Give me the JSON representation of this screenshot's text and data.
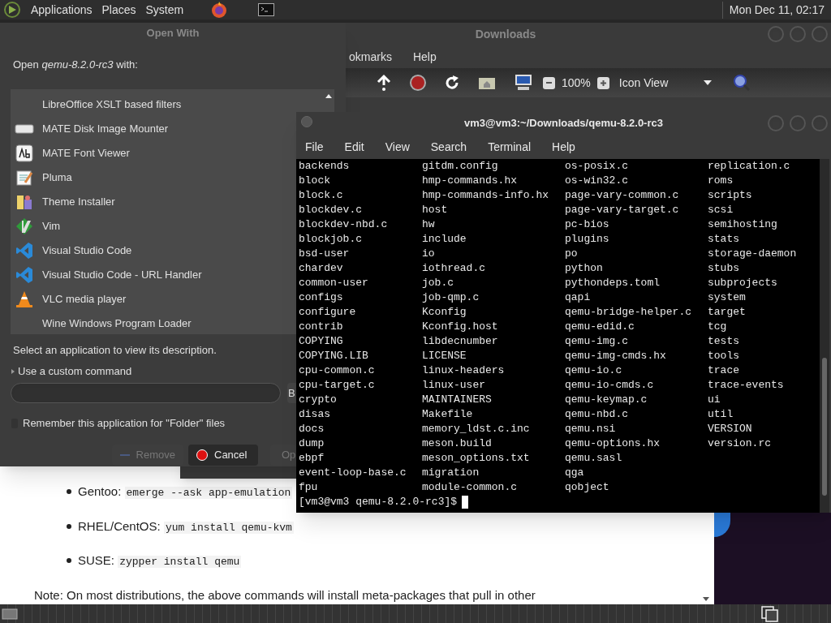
{
  "top_panel": {
    "menus": [
      "Applications",
      "Places",
      "System"
    ],
    "clock": "Mon Dec 11, 02:17"
  },
  "file_manager": {
    "title": "Downloads",
    "menu": [
      "okmarks",
      "Help"
    ],
    "zoom": "100%",
    "view": "Icon View"
  },
  "open_with": {
    "title": "Open With",
    "prompt": "Open *qemu-8.2.0-rc3* with:",
    "apps": [
      {
        "name": "LibreOffice XSLT based filters",
        "selected": false
      },
      {
        "name": "MATE Disk Image Mounter",
        "selected": false
      },
      {
        "name": "MATE Font Viewer",
        "selected": false
      },
      {
        "name": "Pluma",
        "selected": false
      },
      {
        "name": "Theme Installer",
        "selected": false
      },
      {
        "name": "Vim",
        "selected": false
      },
      {
        "name": "Visual Studio Code",
        "selected": false
      },
      {
        "name": "Visual Studio Code - URL Handler",
        "selected": false
      },
      {
        "name": "VLC media player",
        "selected": false
      },
      {
        "name": "Wine Windows Program Loader",
        "selected": false
      }
    ],
    "description": "Select an application to view its description.",
    "custom_command": {
      "label": "Use a custom command",
      "expanded": false
    },
    "browse_button": "B",
    "remember": {
      "label": "Remember this application for \"Folder\" files",
      "checked": false
    },
    "buttons": [
      {
        "label": "Remove",
        "disabled": true
      },
      {
        "label": "Cancel",
        "disabled": false
      },
      {
        "label": "Op",
        "disabled": true
      }
    ]
  },
  "terminal": {
    "title": "vm3@vm3:~/Downloads/qemu-8.2.0-rc3",
    "menu": [
      "File",
      "Edit",
      "View",
      "Search",
      "Terminal",
      "Help"
    ],
    "columns": [
      [
        "backends",
        "block",
        "block.c",
        "blockdev.c",
        "blockdev-nbd.c",
        "blockjob.c",
        "bsd-user",
        "chardev",
        "common-user",
        "configs",
        "configure",
        "contrib",
        "COPYING",
        "COPYING.LIB",
        "cpu-common.c",
        "cpu-target.c",
        "crypto",
        "disas",
        "docs",
        "dump",
        "ebpf",
        "event-loop-base.c",
        "fpu"
      ],
      [
        "gitdm.config",
        "hmp-commands.hx",
        "hmp-commands-info.hx",
        "host",
        "hw",
        "include",
        "io",
        "iothread.c",
        "job.c",
        "job-qmp.c",
        "Kconfig",
        "Kconfig.host",
        "libdecnumber",
        "LICENSE",
        "linux-headers",
        "linux-user",
        "MAINTAINERS",
        "Makefile",
        "memory_ldst.c.inc",
        "meson.build",
        "meson_options.txt",
        "migration",
        "module-common.c"
      ],
      [
        "os-posix.c",
        "os-win32.c",
        "page-vary-common.c",
        "page-vary-target.c",
        "pc-bios",
        "plugins",
        "po",
        "python",
        "pythondeps.toml",
        "qapi",
        "qemu-bridge-helper.c",
        "qemu-edid.c",
        "qemu-img.c",
        "qemu-img-cmds.hx",
        "qemu-io.c",
        "qemu-io-cmds.c",
        "qemu-keymap.c",
        "qemu-nbd.c",
        "qemu.nsi",
        "qemu-options.hx",
        "qemu.sasl",
        "qga",
        "qobject"
      ],
      [
        "replication.c",
        "roms",
        "scripts",
        "scsi",
        "semihosting",
        "stats",
        "storage-daemon",
        "stubs",
        "subprojects",
        "system",
        "target",
        "tcg",
        "tests",
        "tools",
        "trace",
        "trace-events",
        "ui",
        "util",
        "VERSION",
        "version.rc"
      ]
    ],
    "prompt": "[vm3@vm3 qemu-8.2.0-rc3]$"
  },
  "web_page": {
    "items": [
      {
        "label": "Gentoo:",
        "command": "emerge --ask app-emulation"
      },
      {
        "label": "RHEL/CentOS:",
        "command": "yum install qemu-kvm"
      },
      {
        "label": "SUSE:",
        "command": "zypper install qemu"
      }
    ],
    "note": "Note: On most distributions, the above commands will install meta-packages that pull in other"
  }
}
